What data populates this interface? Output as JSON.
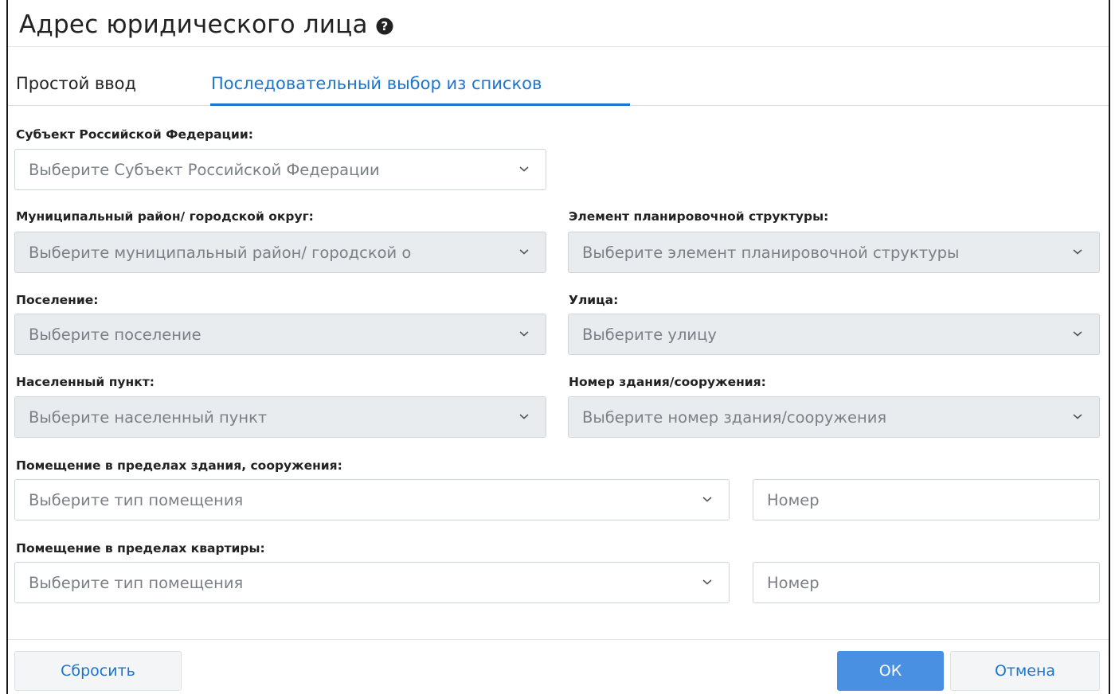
{
  "dialog": {
    "title": "Адрес юридического лица"
  },
  "tabs": [
    {
      "label": "Простой ввод",
      "active": false
    },
    {
      "label": "Последовательный выбор из списков",
      "active": true
    }
  ],
  "fields": {
    "subject": {
      "label": "Субъект Российской Федерации:",
      "placeholder": "Выберите Субъект Российской Федерации",
      "disabled": false
    },
    "municipal": {
      "label": "Муниципальный район/ городской округ:",
      "placeholder": "Выберите муниципальный район/ городской о",
      "disabled": true
    },
    "planning": {
      "label": "Элемент планировочной структуры:",
      "placeholder": "Выберите элемент планировочной структуры",
      "disabled": true
    },
    "settlement": {
      "label": "Поселение:",
      "placeholder": "Выберите поселение",
      "disabled": true
    },
    "street": {
      "label": "Улица:",
      "placeholder": "Выберите улицу",
      "disabled": true
    },
    "locality": {
      "label": "Населенный пункт:",
      "placeholder": "Выберите населенный пункт",
      "disabled": true
    },
    "building": {
      "label": "Номер здания/сооружения:",
      "placeholder": "Выберите номер здания/сооружения",
      "disabled": true
    },
    "room_building": {
      "label": "Помещение в пределах здания, сооружения:",
      "type_placeholder": "Выберите тип помещения",
      "number_placeholder": "Номер"
    },
    "room_apartment": {
      "label": "Помещение в пределах квартиры:",
      "type_placeholder": "Выберите тип помещения",
      "number_placeholder": "Номер"
    }
  },
  "buttons": {
    "reset": "Сбросить",
    "ok": "ОК",
    "cancel": "Отмена"
  },
  "colors": {
    "accent": "#1b75d0",
    "primary_button": "#4a90e2",
    "disabled_field": "#e9ecef"
  },
  "icons": {
    "help": "question-circle-icon",
    "dropdown": "chevron-down-icon"
  }
}
